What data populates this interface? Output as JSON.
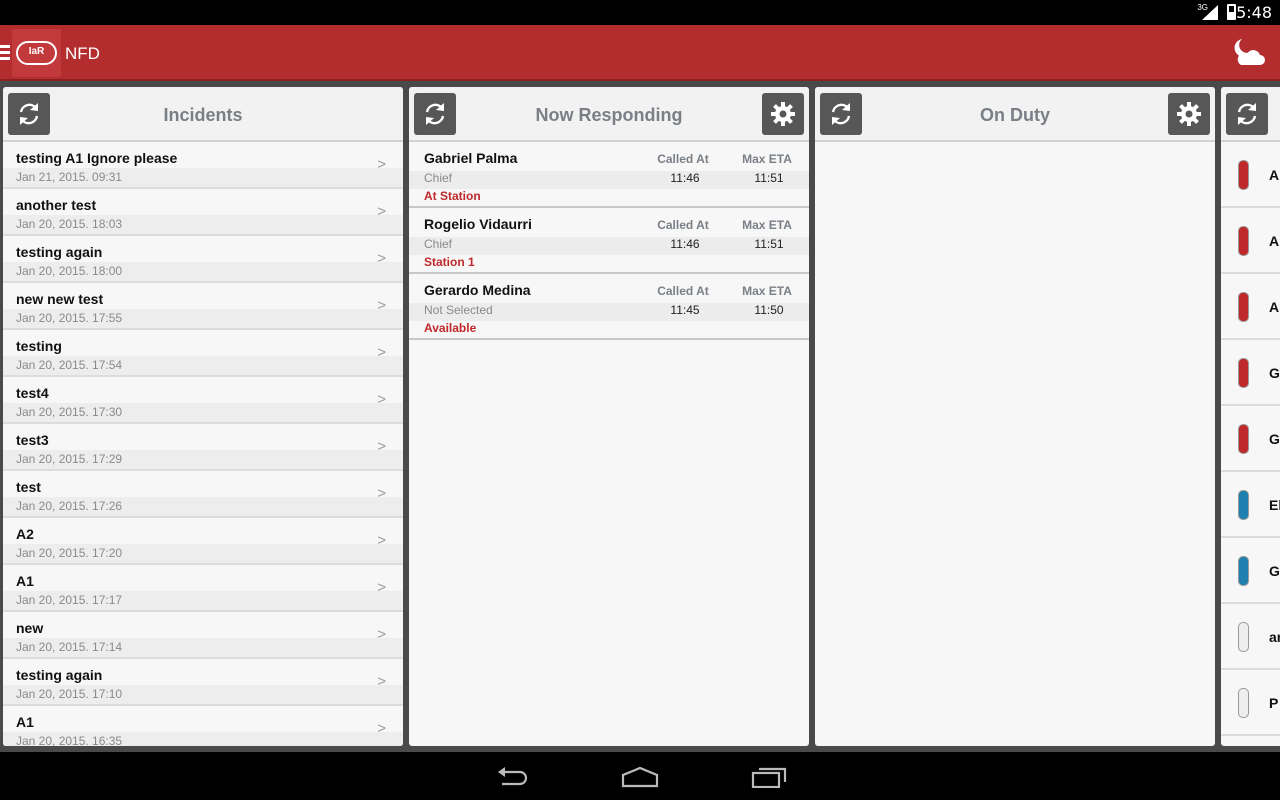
{
  "status_bar": {
    "time": "5:48",
    "network": "3G"
  },
  "action_bar": {
    "logo_text": "IaR",
    "title": "NFD"
  },
  "incidents": {
    "title": "Incidents",
    "items": [
      {
        "title": "testing A1 Ignore please",
        "date": "Jan 21, 2015. 09:31"
      },
      {
        "title": "another test",
        "date": "Jan 20, 2015. 18:03"
      },
      {
        "title": "testing again",
        "date": "Jan 20, 2015. 18:00"
      },
      {
        "title": "new new test",
        "date": "Jan 20, 2015. 17:55"
      },
      {
        "title": "testing",
        "date": "Jan 20, 2015. 17:54"
      },
      {
        "title": "test4",
        "date": "Jan 20, 2015. 17:30"
      },
      {
        "title": "test3",
        "date": "Jan 20, 2015. 17:29"
      },
      {
        "title": "test",
        "date": "Jan 20, 2015. 17:26"
      },
      {
        "title": "A2",
        "date": "Jan 20, 2015. 17:20"
      },
      {
        "title": "A1",
        "date": "Jan 20, 2015. 17:17"
      },
      {
        "title": "new",
        "date": "Jan 20, 2015. 17:14"
      },
      {
        "title": "testing again",
        "date": "Jan 20, 2015. 17:10"
      },
      {
        "title": "A1",
        "date": "Jan 20, 2015. 16:35"
      }
    ]
  },
  "now_responding": {
    "title": "Now Responding",
    "col_called": "Called At",
    "col_eta": "Max ETA",
    "items": [
      {
        "name": "Gabriel Palma",
        "role": "Chief",
        "status": "At Station",
        "called_at": "11:46",
        "max_eta": "11:51"
      },
      {
        "name": "Rogelio Vidaurri",
        "role": "Chief",
        "status": "Station 1",
        "called_at": "11:46",
        "max_eta": "11:51"
      },
      {
        "name": "Gerardo Medina",
        "role": "Not Selected",
        "status": "Available",
        "called_at": "11:45",
        "max_eta": "11:50"
      }
    ]
  },
  "on_duty": {
    "title": "On Duty"
  },
  "apparatus": {
    "items": [
      {
        "label": "A",
        "color": "#c0292b"
      },
      {
        "label": "A",
        "color": "#c0292b"
      },
      {
        "label": "A",
        "color": "#c0292b"
      },
      {
        "label": "G",
        "color": "#c0292b"
      },
      {
        "label": "G",
        "color": "#c0292b"
      },
      {
        "label": "El",
        "color": "#1f7fae"
      },
      {
        "label": "G",
        "color": "#1f7fae"
      },
      {
        "label": "ar",
        "color": "#eeeeee"
      },
      {
        "label": "P",
        "color": "#eeeeee"
      }
    ]
  }
}
